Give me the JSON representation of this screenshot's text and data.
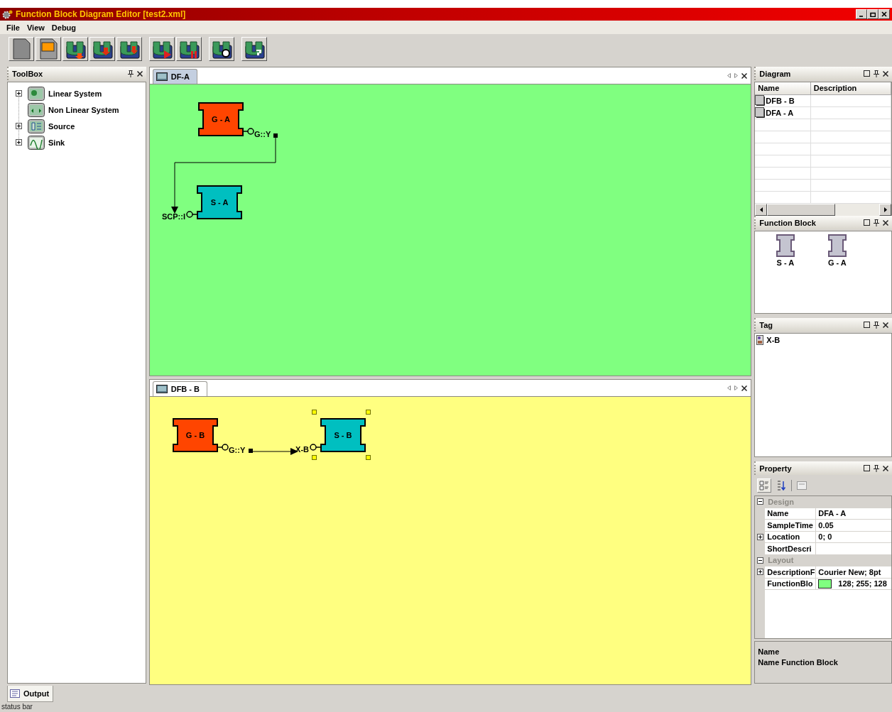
{
  "window": {
    "title": "Function Block Diagram Editor [test2.xml]"
  },
  "menu": [
    {
      "label": "File"
    },
    {
      "label": "View"
    },
    {
      "label": "Debug"
    }
  ],
  "toolbox": {
    "title": "ToolBox",
    "items": [
      {
        "label": "Linear System",
        "has_children": true
      },
      {
        "label": "Non Linear System",
        "has_children": false
      },
      {
        "label": "Source",
        "has_children": true
      },
      {
        "label": "Sink",
        "has_children": true
      }
    ]
  },
  "documents": [
    {
      "tab": "DF-A",
      "selected": true,
      "color": "#80ff80",
      "blocks": [
        {
          "label": "G - A",
          "kind": "output",
          "color": "#ff4500",
          "port": "G::Y",
          "selected": false
        },
        {
          "label": "S - A",
          "kind": "input",
          "color": "#00bfc0",
          "port": "SCP::I",
          "selected": false
        }
      ]
    },
    {
      "tab": "DFB - B",
      "selected": false,
      "color": "#ffff80",
      "blocks": [
        {
          "label": "G - B",
          "kind": "output",
          "color": "#ff4500",
          "port": "G::Y",
          "selected": false
        },
        {
          "label": "S - B",
          "kind": "input",
          "color": "#00bfc0",
          "port": "X-B",
          "selected": true
        }
      ]
    }
  ],
  "diagram_panel": {
    "title": "Diagram",
    "columns": [
      "Name",
      "Description"
    ],
    "rows": [
      {
        "name": "DFB - B"
      },
      {
        "name": "DFA - A"
      }
    ]
  },
  "function_block_panel": {
    "title": "Function Block",
    "items": [
      {
        "label": "S - A"
      },
      {
        "label": "G - A"
      }
    ]
  },
  "tag_panel": {
    "title": "Tag",
    "items": [
      {
        "label": "X-B"
      }
    ]
  },
  "property_panel": {
    "title": "Property",
    "categories": [
      {
        "label": "Design",
        "expanded": true,
        "rows": [
          {
            "name": "Name",
            "value": "DFA - A",
            "expandable": false
          },
          {
            "name": "SampleTime",
            "value": "0.05",
            "expandable": false
          },
          {
            "name": "Location",
            "value": "0; 0",
            "expandable": true
          },
          {
            "name": "ShortDescri",
            "expandable": false
          }
        ]
      },
      {
        "label": "Layout",
        "expanded": true,
        "rows": [
          {
            "name": "DescriptionF",
            "value": "Courier New; 8pt",
            "expandable": true
          },
          {
            "name": "FunctionBlo",
            "value": "128; 255; 128",
            "color": "#80ff80",
            "expandable": false
          }
        ]
      }
    ],
    "description": {
      "title": "Name",
      "text": "Name Function Block"
    }
  },
  "output_tab": {
    "label": "Output"
  },
  "status_bar": {
    "text": "status bar"
  }
}
